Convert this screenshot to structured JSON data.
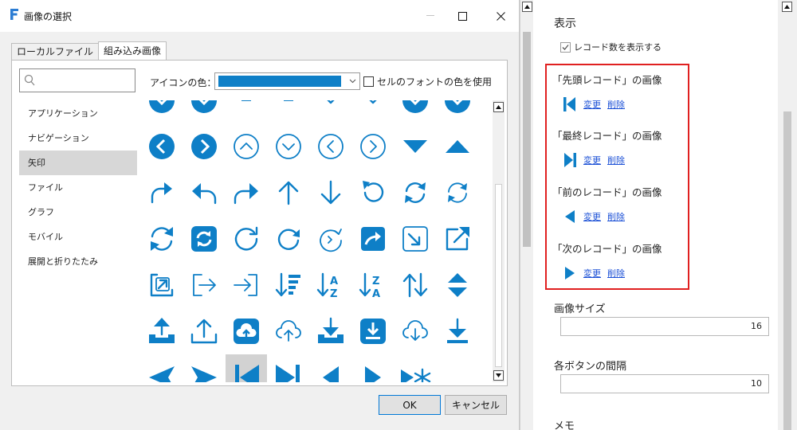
{
  "dialog": {
    "title": "画像の選択",
    "tabs": [
      "ローカルファイル",
      "組み込み画像"
    ],
    "active_tab": 1,
    "search": {
      "value": ""
    },
    "icon_color_label": "アイコンの色：",
    "icon_color": "#0e7fc7",
    "use_font_color_label": "セルのフォントの色を使用",
    "use_font_color_checked": false,
    "categories": [
      "アプリケーション",
      "ナビゲーション",
      "矢印",
      "ファイル",
      "グラフ",
      "モバイル",
      "展開と折りたたみ"
    ],
    "selected_category": "矢印",
    "icon_rows": [
      [
        "circle-down-icon",
        "circle-down-icon",
        "dash-icon",
        "dash-icon",
        "chevron-down-icon",
        "chevron-down-icon",
        "circle-down-icon",
        "circle-down-icon"
      ],
      [
        "circle-chevron-left-icon",
        "circle-chevron-right-icon",
        "circle-outline-chevron-up-icon",
        "circle-outline-chevron-down-icon",
        "circle-outline-chevron-left-icon",
        "circle-outline-chevron-right-icon",
        "triangle-down-icon",
        "triangle-up-icon"
      ],
      [
        "redo-arrow-icon",
        "reply-arrow-icon",
        "share-arrow-icon",
        "arrow-up-icon",
        "arrow-down-icon",
        "undo-circle-icon",
        "sync-icon",
        "sync-outline-icon"
      ],
      [
        "refresh-bold-icon",
        "refresh-square-icon",
        "rotate-right-icon",
        "rotate-right-bold-icon",
        "rotate-light-icon",
        "square-share-icon",
        "square-arrow-down-right-icon",
        "external-link-icon"
      ],
      [
        "square-arrow-up-right-icon",
        "sign-out-icon",
        "sign-in-icon",
        "sort-amount-down-icon",
        "sort-alpha-down-icon",
        "sort-alpha-up-icon",
        "swap-vertical-icon",
        "sort-icon"
      ],
      [
        "upload-tray-icon",
        "upload-outline-icon",
        "cloud-upload-square-icon",
        "cloud-upload-outline-icon",
        "download-tray-icon",
        "download-square-icon",
        "cloud-download-outline-icon",
        "download-bar-icon"
      ],
      [
        "triangle-left-icon",
        "triangle-right-icon",
        "first-record-icon",
        "last-record-icon",
        "caret-left-icon",
        "caret-right-icon",
        "new-record-icon"
      ]
    ],
    "selected_icon": "first-record-icon",
    "ok_label": "OK",
    "cancel_label": "キャンセル"
  },
  "properties": {
    "display_label": "表示",
    "show_count_label": "レコード数を表示する",
    "show_count_checked": true,
    "image_groups": [
      {
        "title": "「先頭レコード」の画像",
        "icon": "first-record-icon",
        "change": "変更",
        "delete": "削除"
      },
      {
        "title": "「最終レコード」の画像",
        "icon": "last-record-icon",
        "change": "変更",
        "delete": "削除"
      },
      {
        "title": "「前のレコード」の画像",
        "icon": "caret-left-icon",
        "change": "変更",
        "delete": "削除"
      },
      {
        "title": "「次のレコード」の画像",
        "icon": "caret-right-icon",
        "change": "変更",
        "delete": "削除"
      }
    ],
    "image_size_label": "画像サイズ",
    "image_size_value": "16",
    "button_spacing_label": "各ボタンの間隔",
    "button_spacing_value": "10",
    "memo_label": "メモ"
  },
  "colors": {
    "accent": "#0e7fc7",
    "highlight_border": "#e02020",
    "link": "#1a4fd6"
  }
}
